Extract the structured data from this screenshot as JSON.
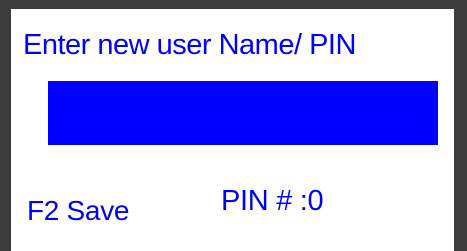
{
  "screen": {
    "prompt": "Enter new user Name/ PIN",
    "name_input": {
      "value": "",
      "placeholder": ""
    },
    "softkey_save_label": "F2 Save",
    "pin_readout": "PIN # :0"
  },
  "colors": {
    "text": "#0000ff",
    "input_fill": "#0000ff",
    "screen_background": "#ffffff",
    "bezel": "#3c3c3c"
  }
}
